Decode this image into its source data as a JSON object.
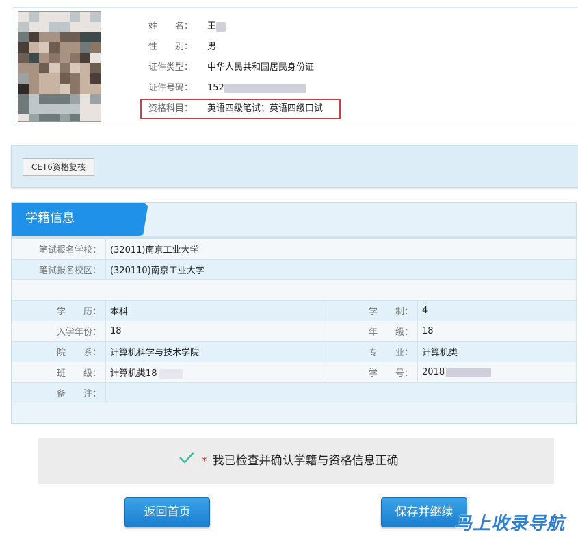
{
  "candidate": {
    "fields": [
      {
        "label": "姓　　名：",
        "value": "王"
      },
      {
        "label": "性　　别：",
        "value": "男"
      },
      {
        "label": "证件类型：",
        "value": "中华人民共和国居民身份证"
      },
      {
        "label": "证件号码：",
        "value": "152"
      },
      {
        "label": "资格科目：",
        "value": "英语四级笔试；英语四级口试"
      }
    ]
  },
  "exam": {
    "tag": "CET6资格复核"
  },
  "school": {
    "title": "学籍信息",
    "rows": [
      {
        "label": "笔试报名学校：",
        "value": "(32011)南京工业大学"
      },
      {
        "label": "笔试报名校区：",
        "value": "(320110)南京工业大学"
      }
    ],
    "pairs": [
      {
        "l1": "学　　历：",
        "v1": "本科",
        "l2": "学　　制：",
        "v2": "4"
      },
      {
        "l1": "入学年份：",
        "v1": "18",
        "l2": "年　　级：",
        "v2": "18"
      },
      {
        "l1": "院　　系：",
        "v1": "计算机科学与技术学院",
        "l2": "专　　业：",
        "v2": "计算机类"
      },
      {
        "l1": "班　　级：",
        "v1": "计算机类18",
        "l2": "学　　号：",
        "v2": "2018"
      }
    ],
    "remark_label": "备　　注：",
    "remark_value": ""
  },
  "confirm": {
    "required_mark": "*",
    "text": "我已检查并确认学籍与资格信息正确",
    "checked": true
  },
  "buttons": {
    "home": "返回首页",
    "save": "保存并继续"
  },
  "watermark": "马上收录导航",
  "colors": {
    "primary": "#1f91e8",
    "highlight": "#d63c3c",
    "check": "#3cb8a2",
    "required": "#d43030"
  },
  "icons": {
    "confirm_icon": "check-icon"
  }
}
